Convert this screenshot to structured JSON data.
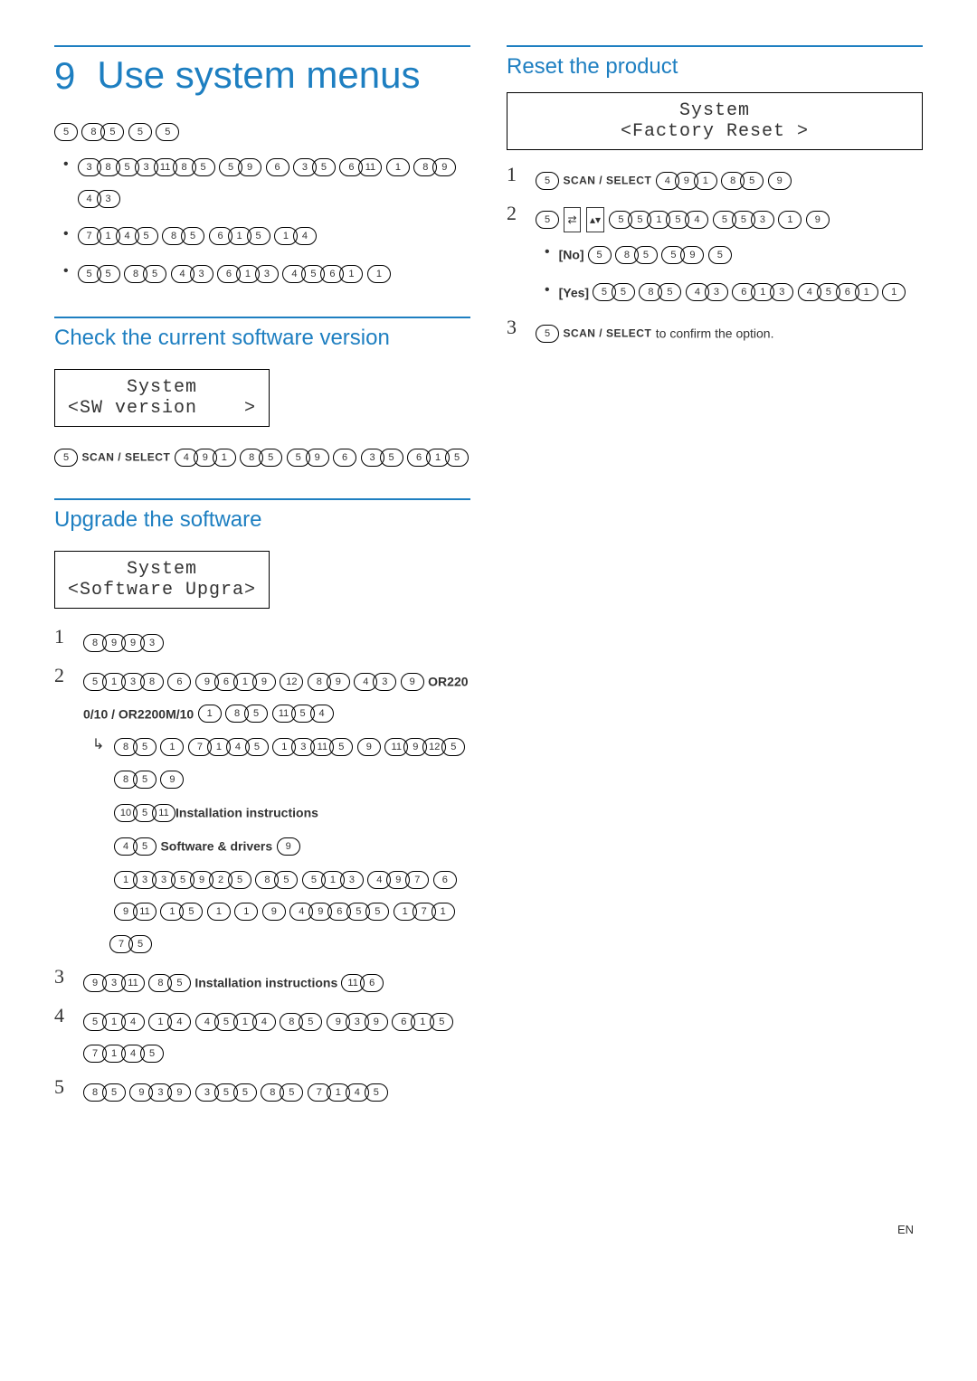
{
  "chapter": {
    "number": "9",
    "title": "Use system menus"
  },
  "left": {
    "intro_line": "5 85 5 5",
    "intro_bullets": [
      "38531185 59 6 35 611 1 89 43",
      "7145 85 615 14",
      "55 85 43 613 4561 1"
    ],
    "check": {
      "title": "Check the current software version",
      "lcd": {
        "line1": "System",
        "line2": "<SW version    >"
      },
      "text_prefix_bubble": "5",
      "text_scan": "SCAN / SELECT",
      "text_after": "491 85 59 6 35 615"
    },
    "upgrade": {
      "title": "Upgrade the software",
      "lcd": {
        "line1": "System",
        "line2": "<Software Upgra>"
      },
      "steps": [
        {
          "num": "1",
          "body": "8993"
        },
        {
          "num": "2",
          "body": "5138 6 9619 12 89 43 9",
          "model_a": "OR2200/10",
          "slash": " / ",
          "model_b": "OR2200M/10",
          "body2": "1 85 1154",
          "arrow_lines": [
            "85 1 7145 13115 9 119125 85 9",
            {
              "type": "mixed",
              "pre": "10511",
              "bold": "Installation instructions",
              "post": ""
            },
            {
              "type": "mixed",
              "pre": "45 ",
              "bold": "Software & drivers",
              "post": " 9"
            },
            "1335925 85 513 497 6 911 15 1 1 9 49655 17175"
          ]
        },
        {
          "num": "3",
          "body_pre": "9311 85",
          "bold": "Installation instructions",
          "body_post": "116"
        },
        {
          "num": "4",
          "body": "514 14 4514 85 939 615 7145"
        },
        {
          "num": "5",
          "body": "85 939 355 85 7145"
        }
      ]
    }
  },
  "right": {
    "reset": {
      "title": "Reset the product",
      "lcd": {
        "line1": "System",
        "line2": "<Factory Reset >"
      },
      "step1": {
        "num": "1",
        "pre": "5",
        "scan": "SCAN / SELECT",
        "after": "491 85 9"
      },
      "step2": {
        "num": "2",
        "pre": "5",
        "icon1": "⇄",
        "icon2": "▴▾",
        "after": "55154 553 1 9",
        "bullets": [
          {
            "label": "[No]",
            "body": "5 85 59 5"
          },
          {
            "label": "[Yes]",
            "body": "55 85 43 613 4561 1"
          }
        ]
      },
      "step3": {
        "num": "3",
        "pre": "5",
        "scan": "SCAN / SELECT",
        "tail": " to confirm the option."
      }
    }
  },
  "footer": "EN"
}
